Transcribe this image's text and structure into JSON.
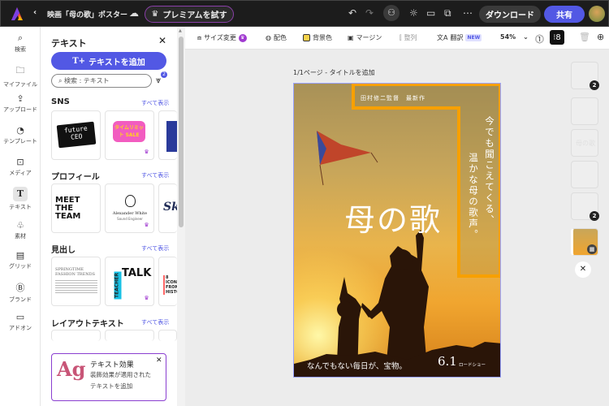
{
  "topbar": {
    "title": "映画「母の歌」ポスター",
    "premium": "プレミアムを試す",
    "download": "ダウンロード",
    "share": "共有"
  },
  "rail": [
    {
      "label": "検索",
      "icon": "search-icon"
    },
    {
      "label": "マイファイル",
      "icon": "folder-icon"
    },
    {
      "label": "アップロード",
      "icon": "upload-icon"
    },
    {
      "label": "テンプレート",
      "icon": "template-icon"
    },
    {
      "label": "メディア",
      "icon": "media-icon"
    },
    {
      "label": "テキスト",
      "icon": "text-icon"
    },
    {
      "label": "素材",
      "icon": "elements-icon"
    },
    {
      "label": "グリッド",
      "icon": "grid-icon"
    },
    {
      "label": "ブランド",
      "icon": "brand-icon"
    },
    {
      "label": "アドオン",
      "icon": "addon-icon"
    }
  ],
  "panel": {
    "title": "テキスト",
    "add": "テキストを追加",
    "search_placeholder": "検索 : テキスト",
    "filter_count": "2",
    "sections": [
      {
        "title": "SNS",
        "see_all": "すべて表示"
      },
      {
        "title": "プロフィール",
        "see_all": "すべて表示"
      },
      {
        "title": "見出し",
        "see_all": "すべて表示"
      },
      {
        "title": "レイアウトテキスト",
        "see_all": "すべて表示"
      }
    ],
    "cards": {
      "future": "future CEO",
      "sale": "タイムリミット SALE",
      "meet": "MEET THE TEAM",
      "alex": "Alexander White",
      "alex_sub": "Sound Engineer",
      "sk": "Sk",
      "spring": "SPRINGTIME FASHION TRENDS",
      "teacher": "TEACHER",
      "talk": "TALK",
      "icons": "8 ICONS FROM HISTO"
    },
    "effect": {
      "ag": "Ag",
      "title": "テキスト効果",
      "desc1": "装飾効果が適用された",
      "desc2": "テキストを追加"
    }
  },
  "toolbar": {
    "resize": "サイズ変更",
    "color": "配色",
    "bg": "背景色",
    "margin": "マージン",
    "align": "整列",
    "translate": "翻訳",
    "new": "NEW",
    "zoom": "54%"
  },
  "canvas": {
    "page_label": "1/1ページ - タイトルを追加"
  },
  "poster": {
    "director": "田村修二監督　最新作",
    "tagline1": "今でも聞こえてくる、",
    "tagline2": "温かな母の歌声。",
    "title": "母の歌",
    "bottom": "なんでもない毎日が、宝物。",
    "date": "6.1",
    "roadshow": "ロードショー"
  },
  "layers": {
    "badge1": "2",
    "badge2": "2",
    "title_thumb": "母の歌"
  }
}
